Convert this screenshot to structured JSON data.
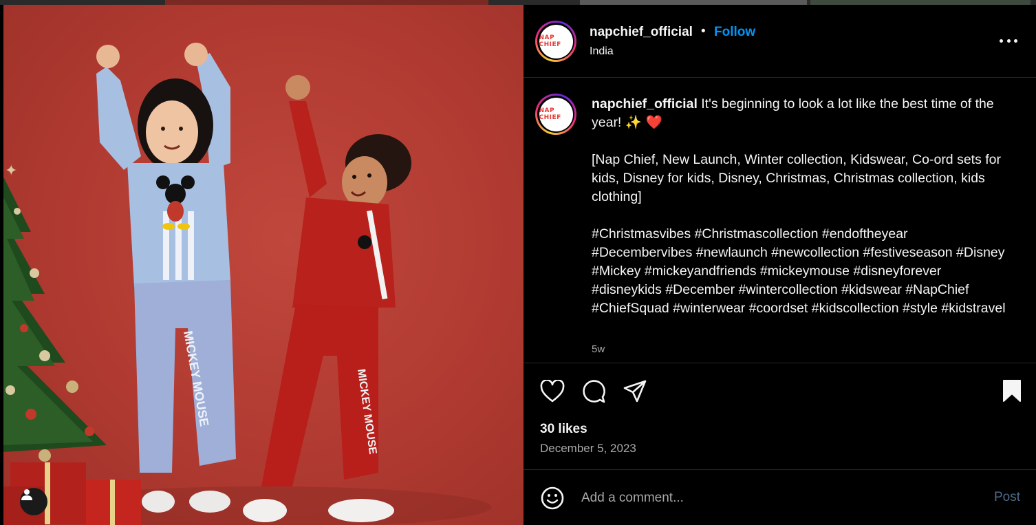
{
  "post": {
    "username": "napchief_official",
    "separator": "•",
    "follow_label": "Follow",
    "location": "India",
    "avatar_logo_text": "NAP CHIEF"
  },
  "caption": {
    "username": "napchief_official",
    "line1": "It's beginning to look a lot like the best time of the year! ✨ ❤️",
    "tags_line": "[Nap Chief, New Launch, Winter collection, Kidswear, Co-ord sets for kids, Disney for kids, Disney, Christmas, Christmas collection, kids clothing]",
    "hashtags": "#Christmasvibes #Christmascollection #endoftheyear #Decembervibes #newlaunch #newcollection #festiveseason #Disney #Mickey #mickeyandfriends #mickeymouse #disneyforever #disneykids #December #wintercollection #kidswear #NapChief #ChiefSquad #winterwear #coordset #kidscollection #style #kidstravel",
    "time_ago": "5w"
  },
  "stats": {
    "likes": "30 likes",
    "date": "December 5, 2023"
  },
  "comment": {
    "placeholder": "Add a comment...",
    "post_label": "Post"
  },
  "photo": {
    "print_girl_pants": "MICKEY MOUSE",
    "print_boy_pants": "MICKEY MOUSE"
  },
  "icons": {
    "like": "heart-icon",
    "comment": "comment-icon",
    "share": "share-icon",
    "save": "bookmark-icon",
    "more": "more-options-icon",
    "emoji": "emoji-icon",
    "user_tag": "user-tag-icon"
  },
  "colors": {
    "follow": "#0095f6",
    "post_disabled": "#4d6a87",
    "background": "#000000",
    "secondary_text": "#a8a8a8",
    "photo_backdrop": "#b03a31"
  }
}
